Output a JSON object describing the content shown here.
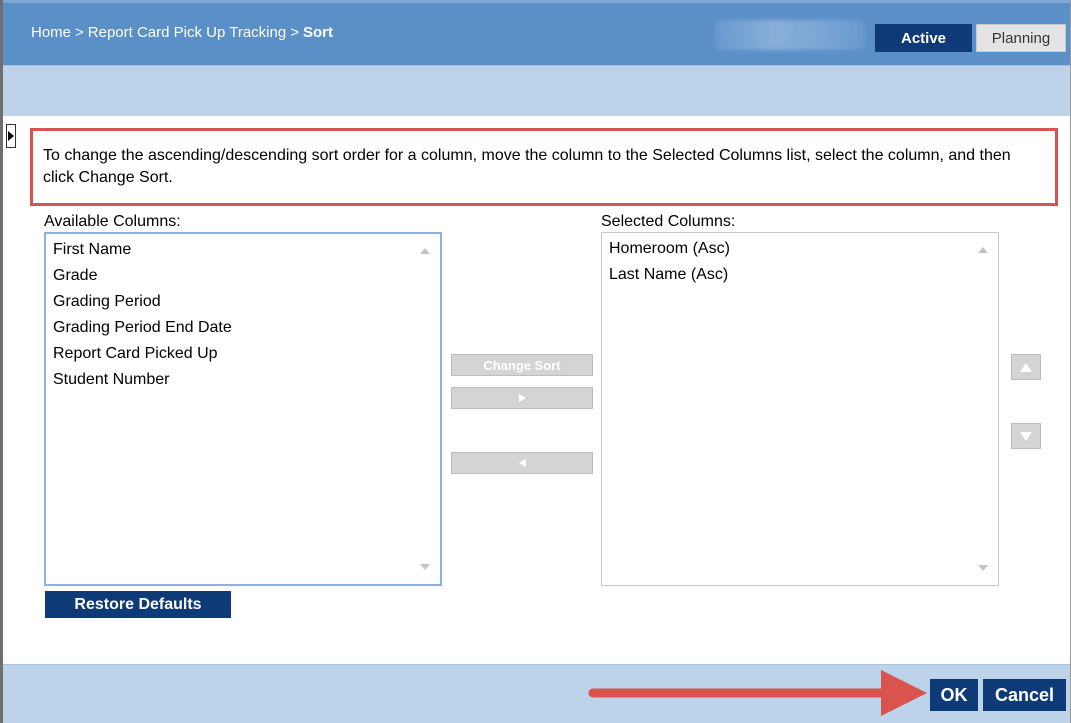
{
  "header": {
    "breadcrumb": {
      "home": "Home",
      "page": "Report Card Pick Up Tracking",
      "current": "Sort",
      "separator": ">"
    },
    "mode_active": "Active",
    "mode_planning": "Planning"
  },
  "instructions": "To change the ascending/descending sort order for a column, move the column to the Selected Columns list, select the column, and then click Change Sort.",
  "available": {
    "label": "Available Columns:",
    "items": [
      "First Name",
      "Grade",
      "Grading Period",
      "Grading Period End Date",
      "Report Card Picked Up",
      "Student Number"
    ]
  },
  "selected": {
    "label": "Selected Columns:",
    "items": [
      "Homeroom (Asc)",
      "Last Name (Asc)"
    ]
  },
  "buttons": {
    "change_sort": "Change Sort",
    "restore_defaults": "Restore Defaults",
    "ok": "OK",
    "cancel": "Cancel"
  },
  "colors": {
    "header_blue": "#5b8fc7",
    "subbar_blue": "#bcd3e9",
    "navy": "#0e3a78",
    "callout_red": "#d9534f"
  },
  "icons": {
    "side_toggle": "triangle-right-icon",
    "move_right": "arrow-right-icon",
    "move_left": "arrow-left-icon",
    "move_up": "triangle-up-icon",
    "move_down": "triangle-down-icon"
  }
}
